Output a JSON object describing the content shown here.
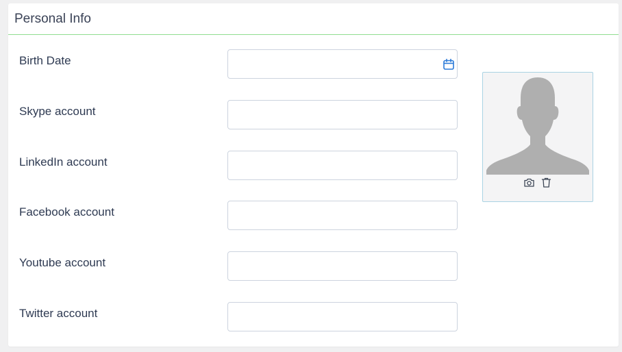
{
  "card": {
    "title": "Personal Info",
    "accent_color": "#8fdc8f"
  },
  "form": {
    "fields": [
      {
        "label": "Birth Date",
        "value": "",
        "placeholder": "",
        "icon": "calendar-icon"
      },
      {
        "label": "Skype account",
        "value": "",
        "placeholder": ""
      },
      {
        "label": "LinkedIn account",
        "value": "",
        "placeholder": ""
      },
      {
        "label": "Facebook account",
        "value": "",
        "placeholder": ""
      },
      {
        "label": "Youtube account",
        "value": "",
        "placeholder": ""
      },
      {
        "label": "Twitter account",
        "value": "",
        "placeholder": ""
      }
    ]
  },
  "avatar": {
    "image": "default-user-silhouette",
    "actions": [
      {
        "icon": "camera-icon",
        "label": "Upload photo"
      },
      {
        "icon": "trash-icon",
        "label": "Delete photo"
      }
    ]
  }
}
